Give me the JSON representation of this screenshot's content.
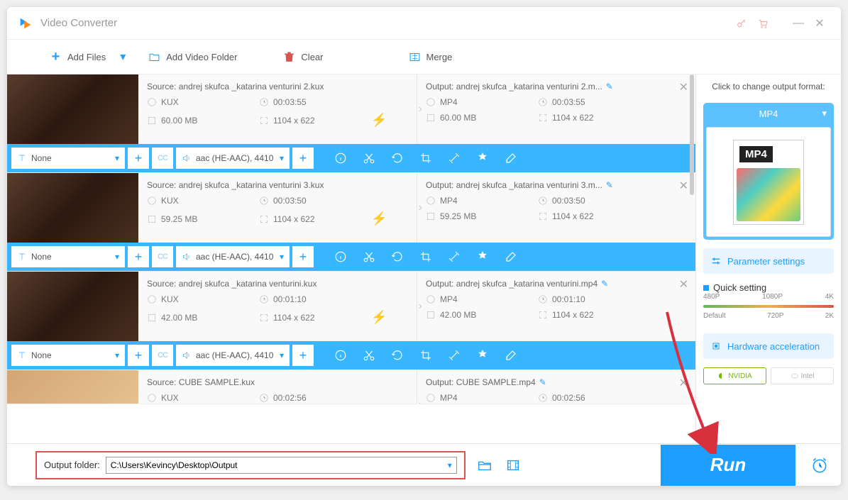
{
  "app": {
    "title": "Video Converter"
  },
  "toolbar": {
    "addFiles": "Add Files",
    "addFolder": "Add Video Folder",
    "clear": "Clear",
    "merge": "Merge"
  },
  "items": [
    {
      "source": "Source: andrej skufca _katarina venturini 2.kux",
      "output": "Output: andrej skufca _katarina venturini 2.m...",
      "srcFmt": "KUX",
      "outFmt": "MP4",
      "srcDur": "00:03:55",
      "outDur": "00:03:55",
      "srcSize": "60.00 MB",
      "outSize": "60.00 MB",
      "srcRes": "1104 x 622",
      "outRes": "1104 x 622",
      "subtitle": "None",
      "audio": "aac (HE-AAC), 4410"
    },
    {
      "source": "Source: andrej skufca _katarina venturini 3.kux",
      "output": "Output: andrej skufca _katarina venturini 3.m...",
      "srcFmt": "KUX",
      "outFmt": "MP4",
      "srcDur": "00:03:50",
      "outDur": "00:03:50",
      "srcSize": "59.25 MB",
      "outSize": "59.25 MB",
      "srcRes": "1104 x 622",
      "outRes": "1104 x 622",
      "subtitle": "None",
      "audio": "aac (HE-AAC), 4410"
    },
    {
      "source": "Source: andrej skufca _katarina venturini.kux",
      "output": "Output: andrej skufca _katarina venturini.mp4",
      "srcFmt": "KUX",
      "outFmt": "MP4",
      "srcDur": "00:01:10",
      "outDur": "00:01:10",
      "srcSize": "42.00 MB",
      "outSize": "42.00 MB",
      "srcRes": "1104 x 622",
      "outRes": "1104 x 622",
      "subtitle": "None",
      "audio": "aac (HE-AAC), 4410"
    },
    {
      "source": "Source: CUBE SAMPLE.kux",
      "output": "Output: CUBE SAMPLE.mp4",
      "srcFmt": "KUX",
      "outFmt": "MP4",
      "srcDur": "00:02:56",
      "outDur": "00:02:56"
    }
  ],
  "right": {
    "clickLabel": "Click to change output format:",
    "format": "MP4",
    "paramSettings": "Parameter settings",
    "quickSetting": "Quick setting",
    "hwAccel": "Hardware acceleration",
    "nvidia": "NVIDIA",
    "intel": "Intel",
    "slider": {
      "t480": "480P",
      "t1080": "1080P",
      "t4k": "4K",
      "bDefault": "Default",
      "b720": "720P",
      "b2k": "2K"
    }
  },
  "footer": {
    "outLabel": "Output folder:",
    "outPath": "C:\\Users\\Kevincy\\Desktop\\Output",
    "run": "Run"
  }
}
